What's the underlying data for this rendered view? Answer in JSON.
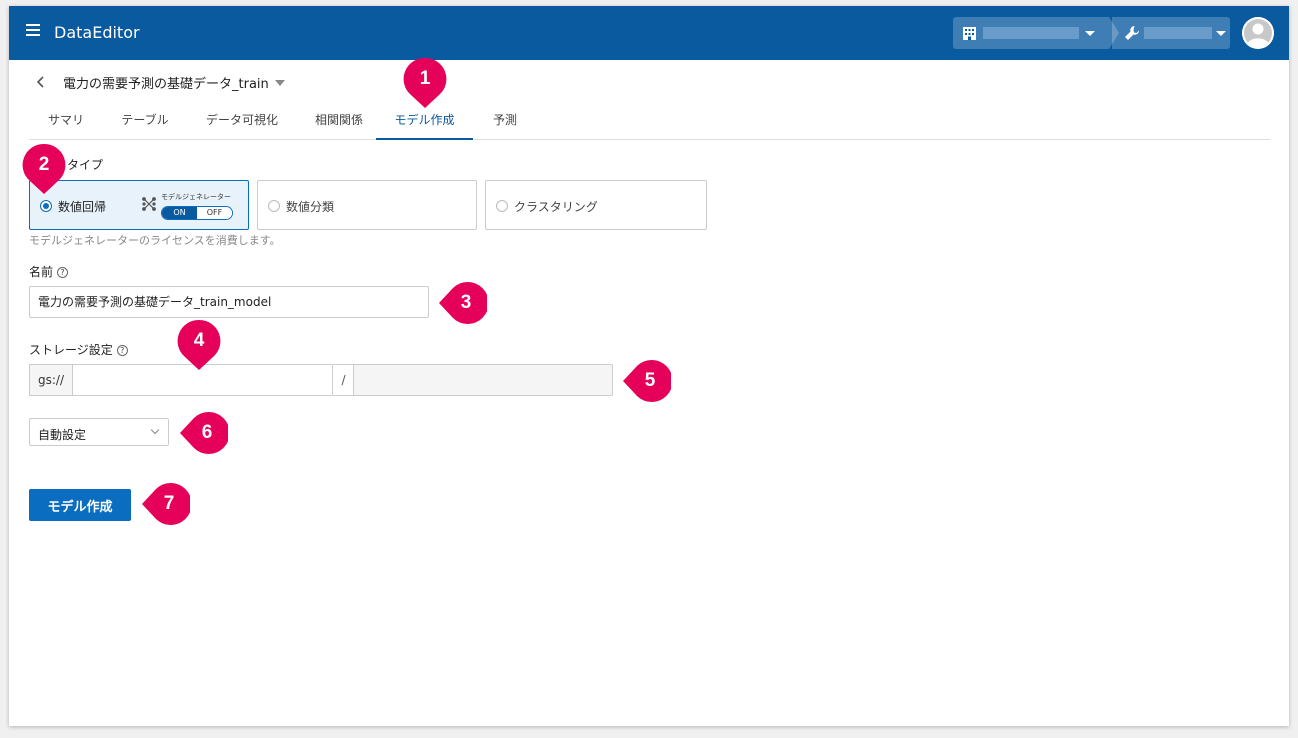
{
  "app": {
    "title": "DataEditor"
  },
  "header": {
    "org_icon": "building-icon",
    "project_icon": "wrench-icon"
  },
  "dataset": {
    "title": "電力の需要予測の基礎データ_train"
  },
  "tabs": [
    {
      "label": "サマリ"
    },
    {
      "label": "テーブル"
    },
    {
      "label": "データ可視化"
    },
    {
      "label": "相関関係"
    },
    {
      "label": "モデル作成",
      "active": true
    },
    {
      "label": "予測"
    }
  ],
  "form": {
    "type_label": "タイプ",
    "types": [
      {
        "label": "数値回帰",
        "selected": true
      },
      {
        "label": "数値分類",
        "selected": false
      },
      {
        "label": "クラスタリング",
        "selected": false
      }
    ],
    "model_generator": {
      "label": "モデルジェネレーター",
      "on": "ON",
      "off": "OFF"
    },
    "license_note": "モデルジェネレーターのライセンスを消費します。",
    "name_label": "名前",
    "name_value": "電力の需要予測の基礎データ_train_model",
    "storage_label": "ストレージ設定",
    "storage_prefix": "gs://",
    "storage_separator": "/",
    "storage_bucket": "",
    "storage_path": "",
    "storage_mode": "自動設定",
    "submit_label": "モデル作成"
  },
  "callouts": [
    "1",
    "2",
    "3",
    "4",
    "5",
    "6",
    "7"
  ],
  "colors": {
    "header": "#0a5aa0",
    "accent": "#0a6dbf",
    "callout": "#e5005a"
  }
}
